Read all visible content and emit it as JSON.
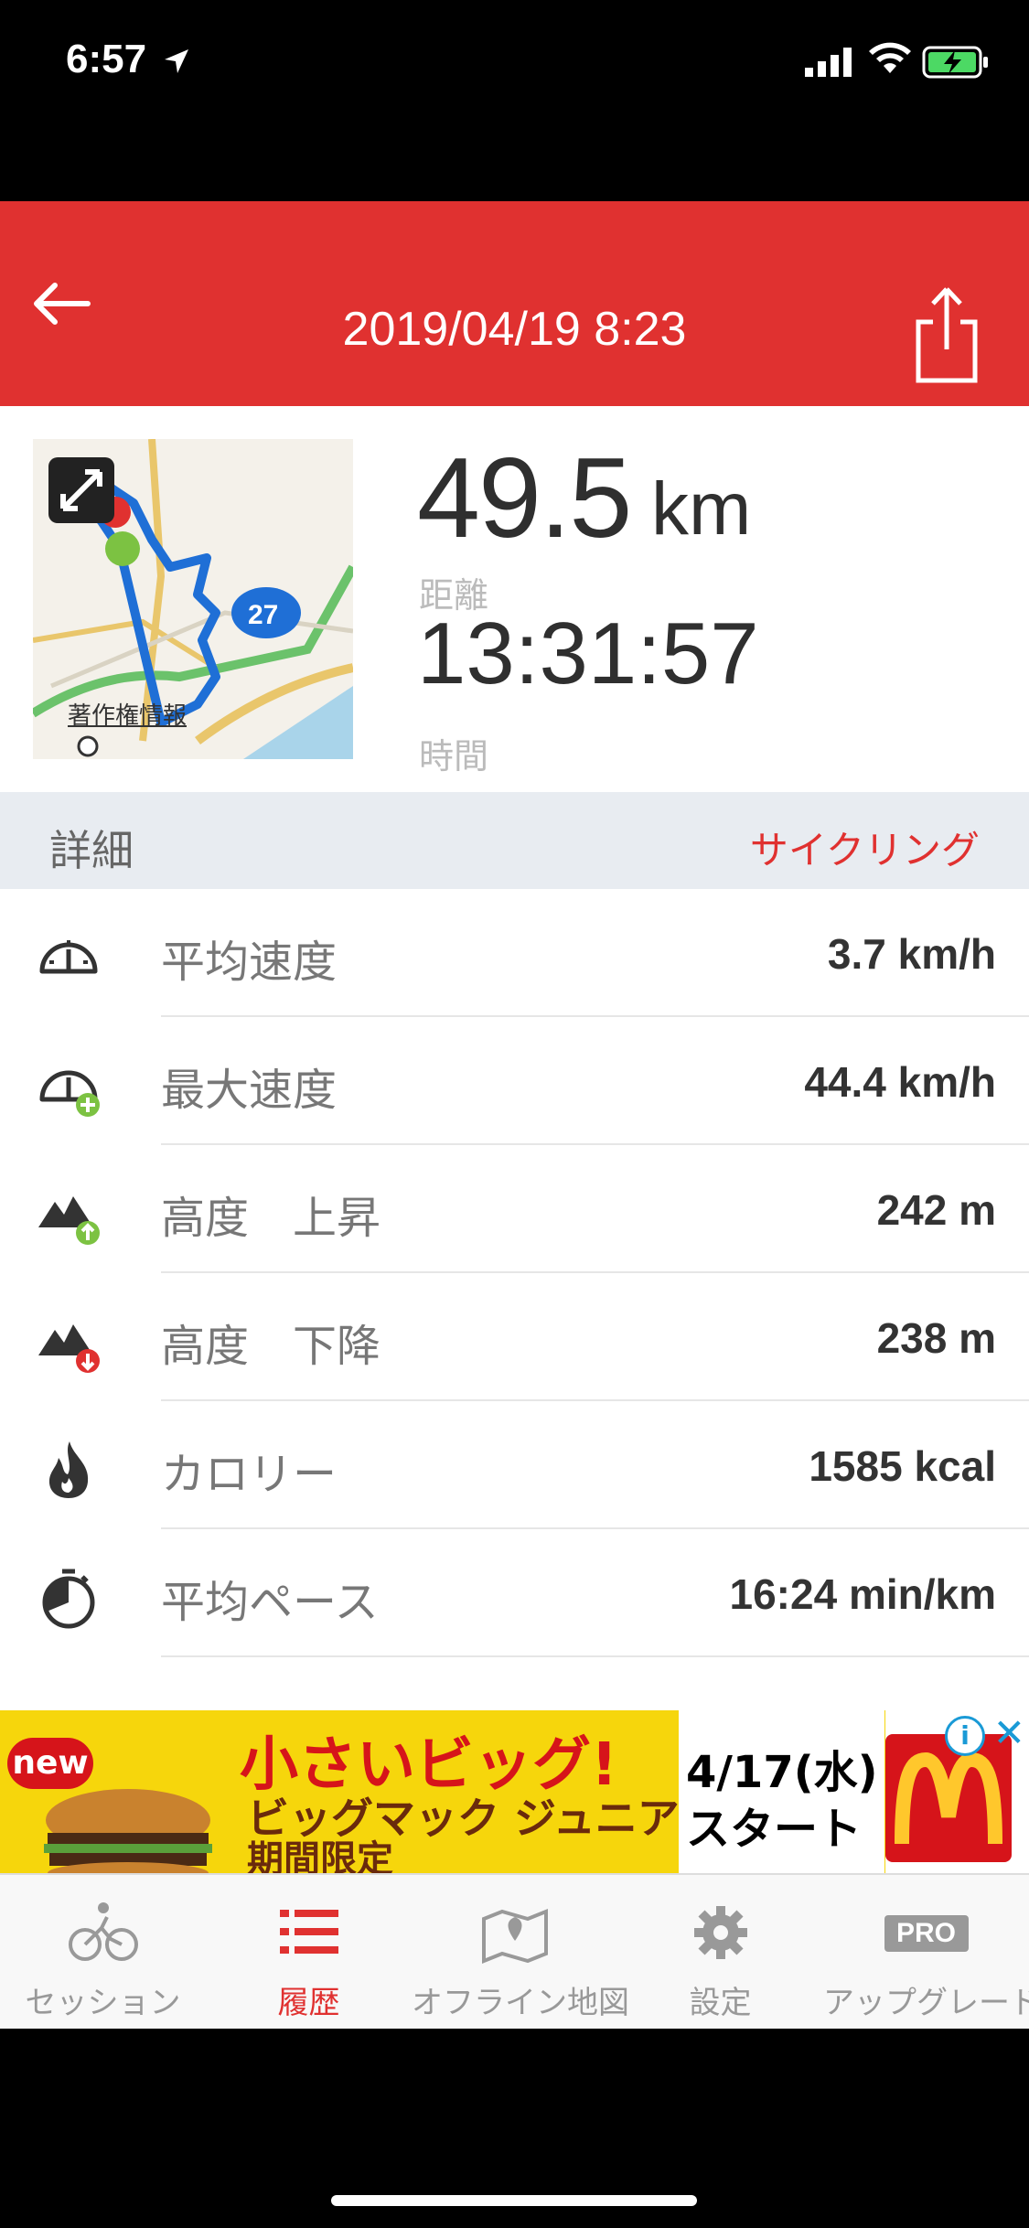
{
  "status_bar": {
    "time": "6:57"
  },
  "header": {
    "title": "2019/04/19 8:23",
    "back_icon": "arrow-left-icon",
    "share_icon": "share-icon"
  },
  "map": {
    "copyright": "著作権情報",
    "route_number": "27"
  },
  "summary": {
    "distance": "49.5",
    "distance_unit": "km",
    "distance_label": "距離",
    "duration": "13:31:57",
    "duration_label": "時間"
  },
  "details": {
    "label": "詳細",
    "activity": "サイクリング",
    "rows": [
      {
        "label": "平均速度",
        "value": "3.7 km/h",
        "icon": "speedometer-icon"
      },
      {
        "label": "最大速度",
        "value": "44.4 km/h",
        "icon": "speedometer-plus-icon"
      },
      {
        "label": "高度　上昇",
        "value": "242 m",
        "icon": "elevation-up-icon"
      },
      {
        "label": "高度　下降",
        "value": "238 m",
        "icon": "elevation-down-icon"
      },
      {
        "label": "カロリー",
        "value": "1585 kcal",
        "icon": "flame-icon"
      },
      {
        "label": "平均ペース",
        "value": "16:24 min/km",
        "icon": "stopwatch-icon"
      }
    ]
  },
  "ad": {
    "badge": "new",
    "headline": "小さいビッグ!",
    "subline1": "ビッグマック ジュニア",
    "subline2": "期間限定",
    "date": "4/17(水)",
    "start": "スタート",
    "logo_letter": "M"
  },
  "tabs": [
    {
      "label": "セッション",
      "icon": "cycling-icon",
      "active": false
    },
    {
      "label": "履歴",
      "icon": "list-icon",
      "active": true
    },
    {
      "label": "オフライン地図",
      "icon": "map-pin-icon",
      "active": false
    },
    {
      "label": "設定",
      "icon": "gear-icon",
      "active": false
    },
    {
      "label": "アップグレード",
      "icon": "pro-badge-icon",
      "badge": "PRO",
      "active": false
    }
  ],
  "colors": {
    "accent": "#e03130",
    "detail_bg": "#e8ecf1",
    "route": "#1f6fd6"
  }
}
